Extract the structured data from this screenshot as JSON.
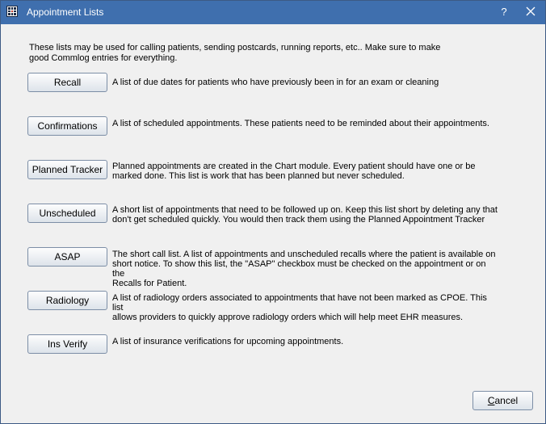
{
  "window": {
    "title": "Appointment Lists",
    "help_label": "?",
    "title_bar_color": "#3f6fae"
  },
  "intro_text": "These lists may be used for calling patients, sending postcards, running reports, etc..  Make sure to make\ngood Commlog entries for everything.",
  "lists": [
    {
      "label": "Recall",
      "description": "A list of due dates for patients who have previously been in for an exam or cleaning"
    },
    {
      "label": "Confirmations",
      "description": "A list of scheduled appointments.  These patients need to be reminded about their appointments."
    },
    {
      "label": "Planned Tracker",
      "description": "Planned appointments are created in the Chart module.  Every patient should have one or be\nmarked done.  This list is work that has been planned but never scheduled."
    },
    {
      "label": "Unscheduled",
      "description": "A short list of appointments that need to be followed up on.   Keep this list short by deleting any that\ndon't get scheduled quickly.  You would then track them  using the Planned Appointment Tracker"
    },
    {
      "label": "ASAP",
      "description": "The short call list. A list of appointments and unscheduled recalls where the patient is available on\nshort notice. To show this list, the \"ASAP\" checkbox must be checked on the appointment or on the\nRecalls for Patient."
    },
    {
      "label": "Radiology",
      "description": "A list of radiology orders associated to appointments that have not been marked as CPOE.  This list\nallows providers to quickly approve radiology orders which will help meet EHR measures."
    },
    {
      "label": "Ins Verify",
      "description": "A list of insurance verifications for upcoming appointments."
    }
  ],
  "footer": {
    "cancel_label_first": "C",
    "cancel_label_rest": "ancel"
  }
}
